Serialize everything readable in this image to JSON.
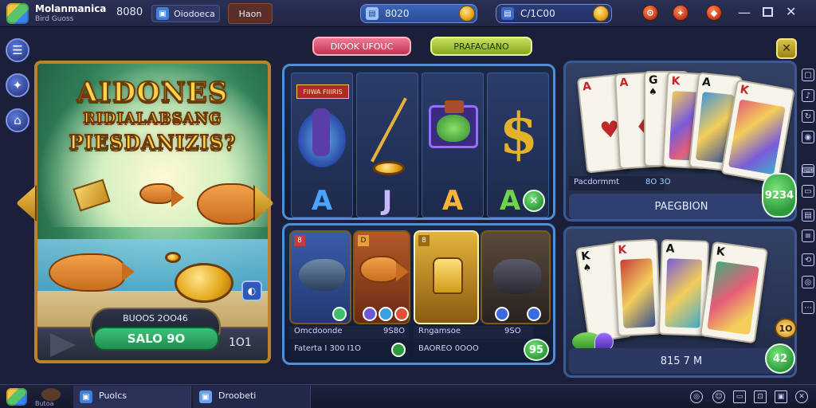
{
  "topbar": {
    "app_name": "Molanmanica",
    "app_sub": "Bird Guoss",
    "counter": "8080",
    "tab1_label": "Oiodoeca",
    "tab2_label": "Haon",
    "balance1": "8020",
    "balance2": "C/1C00",
    "icons": [
      "settings-icon",
      "fire-icon",
      "shield-icon"
    ]
  },
  "left_nav": {
    "items": [
      "home-icon",
      "star-icon",
      "lock-icon"
    ]
  },
  "left_panel": {
    "title_line1": "AIDONES",
    "title_line2": "RIDIALABSANG",
    "title_line3": "PIESDANIZIS?",
    "bonus_label": "BUOOS 2OO46",
    "button_label": "SALO 9O",
    "side_value": "1O1"
  },
  "header_buttons": {
    "left": "DIOOK UFOUC",
    "right": "PRAFACIANO"
  },
  "slot_top": {
    "banner": "FIIWA FIIIRIS",
    "letters": [
      "A",
      "J",
      "A",
      "A"
    ],
    "badge_icon": "swords-icon"
  },
  "slot_bottom": {
    "row1_left": "Omcdoonde",
    "row1_value": "9S8O",
    "row1_right": "Rngamsoe",
    "row1_right_value": "9SO",
    "row2_left": "Faterta I 300 I1O",
    "row2_right": "BAOREO 0OOO",
    "badge_value": "95"
  },
  "right_top": {
    "label_small": "Pacdormmt",
    "label_small_value": "8O 3O",
    "label_main": "PAEGBION",
    "value": "9234",
    "cards": [
      {
        "rank": "A",
        "suit": "♥",
        "color": "red"
      },
      {
        "rank": "A",
        "suit": "♦",
        "color": "red"
      },
      {
        "rank": "G",
        "suit": "♠",
        "color": "black"
      },
      {
        "rank": "K",
        "suit": "♥",
        "color": "red"
      },
      {
        "rank": "A",
        "suit": "♠",
        "color": "black"
      },
      {
        "rank": "K",
        "suit": "♦",
        "color": "red"
      }
    ]
  },
  "right_bottom": {
    "label_main": "815 7 M",
    "value": "42",
    "small_value": "1O",
    "cards": [
      {
        "rank": "K",
        "suit": "♠",
        "color": "black"
      },
      {
        "rank": "K",
        "suit": "♥",
        "color": "red"
      },
      {
        "rank": "A",
        "suit": "♠",
        "color": "black"
      },
      {
        "rank": "K",
        "suit": "♠",
        "color": "black"
      }
    ]
  },
  "taskbar": {
    "app_small": "Butoa",
    "tab1": "Puolcs",
    "tab2": "Droobeti"
  },
  "colors": {
    "accent_blue": "#4e8fd6",
    "gold": "#ffd24a",
    "green": "#2c9b3a",
    "pink_button": "#d94a6b",
    "lime_button": "#a6c83a"
  }
}
